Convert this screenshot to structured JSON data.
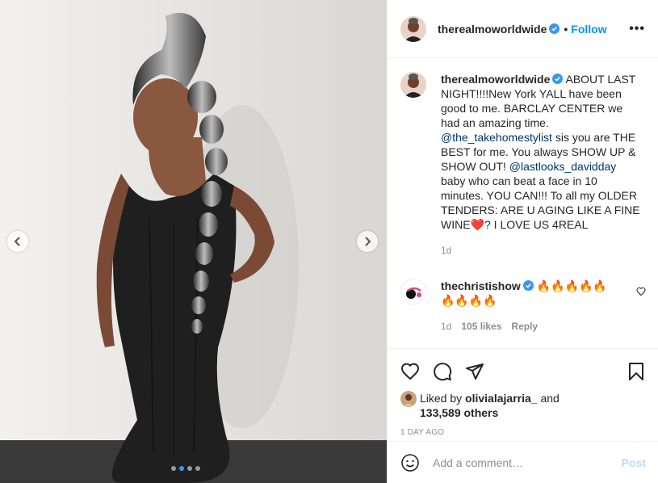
{
  "post": {
    "username": "therealmoworldwide",
    "follow_label": "Follow",
    "bullet": "•",
    "more": "•••",
    "caption_1": "ABOUT LAST NIGHT!!!!New York YALL have been good to me. BARCLAY CENTER we had an amazing time.",
    "mention_1": "@the_takehomestylist",
    "caption_2": "sis you are THE BEST for me. You always SHOW UP & SHOW OUT!",
    "mention_2": "@lastlooks_davidday",
    "caption_3": "baby who can beat a face in 10 minutes. YOU CAN!!! To all my OLDER TENDERS: ARE U AGING LIKE A FINE WINE",
    "caption_emoji": "❤️",
    "caption_4": "? I LOVE US 4REAL",
    "caption_age": "1d"
  },
  "comment": {
    "username": "thechristishow",
    "text": "🔥🔥🔥🔥🔥🔥🔥🔥🔥",
    "age": "1d",
    "likes": "105 likes",
    "reply": "Reply"
  },
  "engagement": {
    "liked_by_prefix": "Liked by",
    "liked_by_user": "olivialajarria_",
    "and": "and",
    "others": "133,589 others",
    "timestamp": "1 DAY AGO"
  },
  "composer": {
    "placeholder": "Add a comment…",
    "post_label": "Post"
  },
  "colors": {
    "accent": "#0095f6",
    "verified": "#3897f0"
  },
  "carousel": {
    "slide_count": 4,
    "active_index": 1
  }
}
